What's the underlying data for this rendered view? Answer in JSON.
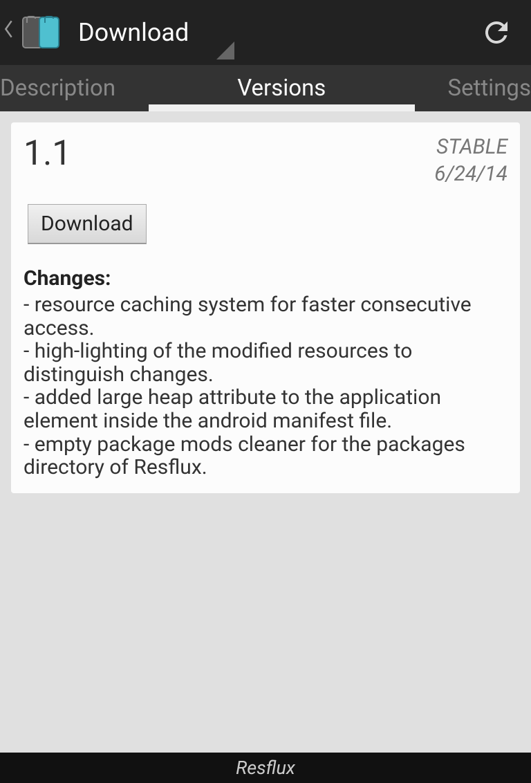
{
  "header": {
    "title": "Download"
  },
  "tabs": {
    "description": "Description",
    "versions": "Versions",
    "settings": "Settings"
  },
  "card": {
    "version": "1.1",
    "stability": "STABLE",
    "date": "6/24/14",
    "download_label": "Download",
    "changes_heading": "Changes:",
    "changes_body": "- resource caching system for faster consecutive access.\n- high-lighting of the modified resources to distinguish changes.\n- added large heap attribute to the application element inside the android manifest file.\n- empty package mods cleaner for the packages directory of Resflux."
  },
  "footer": {
    "app_name": "Resflux"
  }
}
